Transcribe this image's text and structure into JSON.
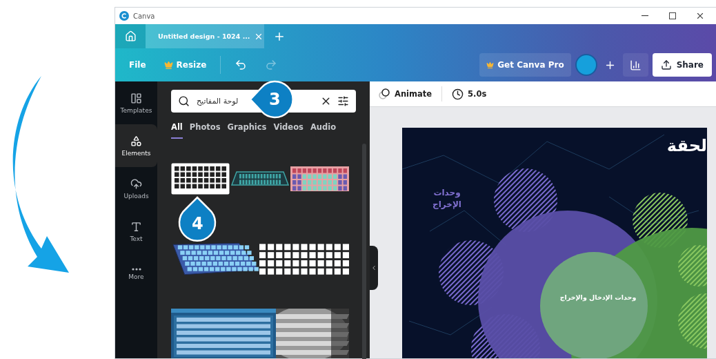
{
  "window": {
    "title": "Canva"
  },
  "tabs": [
    {
      "label": "Untitled design - 1024 ...",
      "selected": true
    }
  ],
  "toolbar": {
    "file": "File",
    "resize": "Resize",
    "get_pro": "Get Canva Pro",
    "share": "Share"
  },
  "sidebar": {
    "items": [
      {
        "label": "Templates",
        "kind": "templates",
        "selected": false
      },
      {
        "label": "Elements",
        "kind": "elements",
        "selected": true
      },
      {
        "label": "Uploads",
        "kind": "uploads",
        "selected": false
      },
      {
        "label": "Text",
        "kind": "text",
        "selected": false
      },
      {
        "label": "More",
        "kind": "more",
        "selected": false
      }
    ]
  },
  "search": {
    "value": "لوحة المفاتيح"
  },
  "filters": [
    {
      "label": "All",
      "selected": true
    },
    {
      "label": "Photos",
      "selected": false
    },
    {
      "label": "Graphics",
      "selected": false
    },
    {
      "label": "Videos",
      "selected": false
    },
    {
      "label": "Audio",
      "selected": false
    }
  ],
  "results": [
    [
      {
        "kind": "outline"
      },
      {
        "kind": "flat"
      },
      {
        "kind": "colorful"
      }
    ],
    [
      {
        "kind": "isometric"
      },
      {
        "kind": "keys"
      }
    ],
    [
      {
        "kind": "picture"
      },
      {
        "kind": "picture"
      }
    ]
  ],
  "callouts": [
    "3",
    "4"
  ],
  "canvas_bar": {
    "animate": "Animate",
    "duration": "5.0s"
  },
  "slide": {
    "title": "لحقة",
    "side_label": [
      "وحدات",
      "الإخراج"
    ],
    "center_label": "وحدات الإدخال والإخراج"
  }
}
